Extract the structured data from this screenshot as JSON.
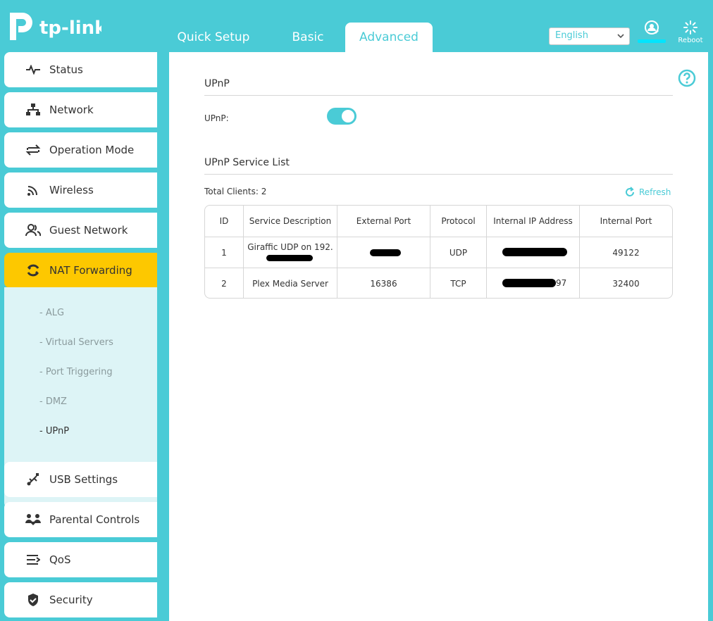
{
  "brand": {
    "logo_text": "tp-link",
    "accent": "#4acbd6",
    "highlight": "#fdc800"
  },
  "tabs": [
    {
      "label": "Quick Setup"
    },
    {
      "label": "Basic"
    },
    {
      "label": "Advanced"
    }
  ],
  "language": {
    "selected": "English"
  },
  "header": {
    "reboot_label": "Reboot"
  },
  "sidebar": {
    "items": [
      {
        "label": "Status",
        "icon": "status-icon"
      },
      {
        "label": "Network",
        "icon": "network-icon"
      },
      {
        "label": "Operation Mode",
        "icon": "operation-mode-icon"
      },
      {
        "label": "Wireless",
        "icon": "wireless-icon"
      },
      {
        "label": "Guest Network",
        "icon": "guest-network-icon"
      },
      {
        "label": "NAT Forwarding",
        "icon": "nat-forwarding-icon"
      },
      {
        "label": "USB Settings",
        "icon": "usb-icon"
      },
      {
        "label": "Parental Controls",
        "icon": "parental-controls-icon"
      },
      {
        "label": "QoS",
        "icon": "qos-icon"
      },
      {
        "label": "Security",
        "icon": "security-icon"
      }
    ],
    "submenu": [
      {
        "label": "- ALG"
      },
      {
        "label": "- Virtual Servers"
      },
      {
        "label": "- Port Triggering"
      },
      {
        "label": "- DMZ"
      },
      {
        "label": "- UPnP"
      }
    ]
  },
  "upnp": {
    "section_title": "UPnP",
    "field_label": "UPnP:",
    "enabled": true,
    "list_title": "UPnP Service List",
    "total_clients_label": "Total Clients: 2",
    "refresh_label": "Refresh",
    "columns": [
      "ID",
      "Service Description",
      "External Port",
      "Protocol",
      "Internal IP Address",
      "Internal Port"
    ],
    "rows": [
      {
        "id": "1",
        "description": "Giraffic UDP on 192.",
        "external_port": "",
        "protocol": "UDP",
        "internal_ip": "",
        "internal_port": "49122"
      },
      {
        "id": "2",
        "description": "Plex Media Server",
        "external_port": "16386",
        "protocol": "TCP",
        "internal_ip": "97",
        "internal_port": "32400"
      }
    ]
  }
}
